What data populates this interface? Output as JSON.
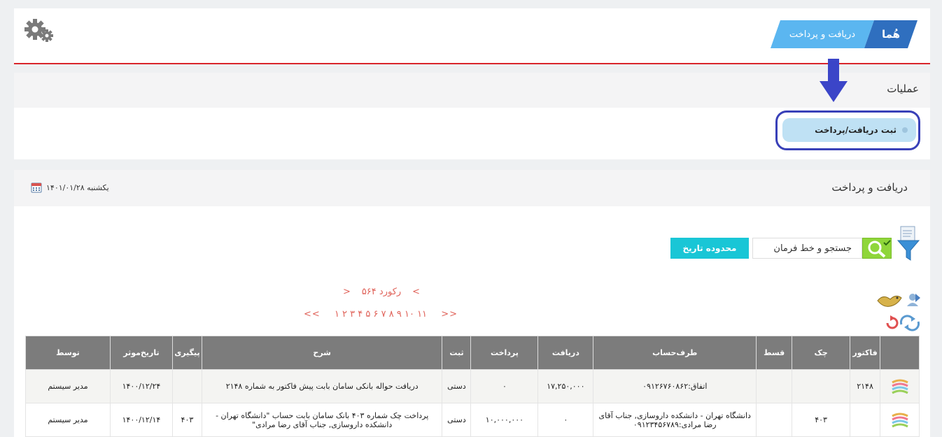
{
  "breadcrumb": {
    "home": "هُما",
    "page": "دریافت و پرداخت"
  },
  "operations": {
    "title": "عملیات",
    "register_label": "ثبت دریافت/پرداخت"
  },
  "main": {
    "title": "دریافت و پرداخت",
    "date": "یکشنبه ۱۴۰۱/۰۱/۲۸",
    "search_value": "جستجو و خط فرمان",
    "date_range_label": "محدوده تاریخ",
    "record_count": "۵۶۴ رکورد",
    "pager_prev": "<",
    "pager_next": ">",
    "pages": "۱ ۲ ۳ ۴ ۵ ۶ ۷ ۸ ۹ ۱۰ ۱۱",
    "pager_first": "<<",
    "pager_last": ">>"
  },
  "table": {
    "columns": [
      "",
      "فاکتور",
      "چک",
      "قسط",
      "طرف‌حساب",
      "دریافت",
      "پرداخت",
      "ثبت",
      "شرح",
      "پیگیری",
      "تاریخ‌موثر",
      "توسط"
    ],
    "rows": [
      {
        "invoice": "۲۱۴۸",
        "cheque": "",
        "installment": "",
        "party": "اتفاق:۰۹۱۲۶۷۶۰۸۶۲",
        "receive": "۱۷,۲۵۰,۰۰۰",
        "pay": "۰",
        "entry": "دستی",
        "description": "دریافت حواله بانکی سامان بابت پیش فاکتور به شماره ۲۱۴۸",
        "tracking": "",
        "date": "۱۴۰۰/۱۲/۲۴",
        "by": "مدیر سیستم"
      },
      {
        "invoice": "",
        "cheque": "۴۰۳",
        "installment": "",
        "party": "دانشگاه تهران - دانشکده داروسازی, جناب آقای رضا مرادی:۰۹۱۲۳۴۵۶۷۸۹",
        "receive": "۰",
        "pay": "۱۰,۰۰۰,۰۰۰",
        "entry": "دستی",
        "description": "پرداخت چک شماره ۴۰۳ بانک سامان بابت حساب \"دانشگاه تهران - دانشکده داروسازی, جناب آقای رضا مرادی\"",
        "tracking": "۴۰۳",
        "date": "۱۴۰۰/۱۲/۱۴",
        "by": "مدیر سیستم"
      }
    ]
  },
  "colors": {
    "accent_red": "#d9262c",
    "breadcrumb_dark": "#2f6fbf",
    "breadcrumb_light": "#5bb6f0",
    "highlight": "#3940b8",
    "search_green": "#8fd63a",
    "date_range_cyan": "#19c6d6",
    "pager_red": "#e0635a",
    "table_header": "#7c7c7c"
  },
  "icons": [
    "gear-icon",
    "down-arrow-icon",
    "calendar-icon",
    "filter-icon",
    "search-icon",
    "bird-icon",
    "user-export-icon",
    "refresh-icon",
    "sync-icon",
    "row-stack-icon"
  ]
}
